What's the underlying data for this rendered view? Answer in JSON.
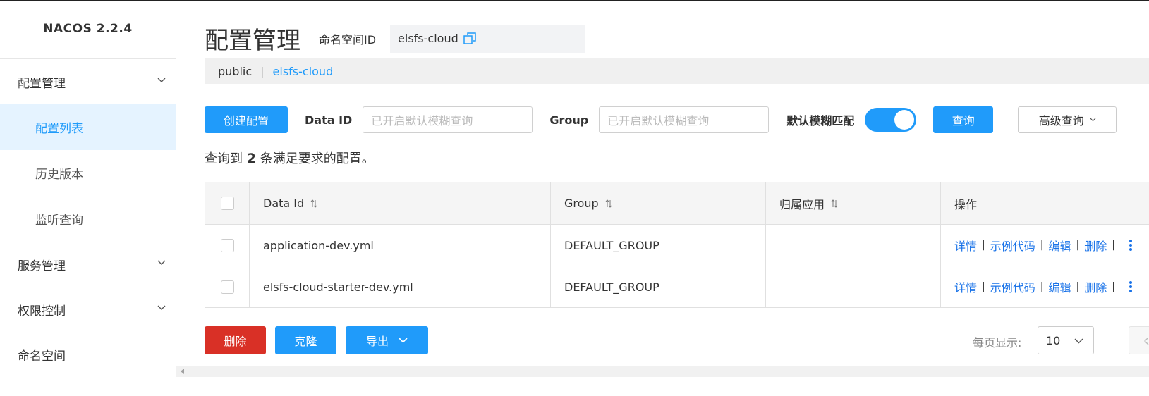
{
  "sidebar": {
    "brand": "NACOS 2.2.4",
    "groups": [
      {
        "label": "配置管理",
        "items": [
          "配置列表",
          "历史版本",
          "监听查询"
        ]
      },
      {
        "label": "服务管理"
      },
      {
        "label": "权限控制"
      },
      {
        "label": "命名空间"
      }
    ],
    "active_item": "配置列表"
  },
  "header": {
    "title": "配置管理",
    "namespace_label": "命名空间ID",
    "namespace_value": "elsfs-cloud"
  },
  "namespace_bar": {
    "items": [
      "public",
      "elsfs-cloud"
    ],
    "separator": "|",
    "selected": "elsfs-cloud"
  },
  "filters": {
    "create_label": "创建配置",
    "data_id_label": "Data ID",
    "data_id_placeholder": "已开启默认模糊查询",
    "group_label": "Group",
    "group_placeholder": "已开启默认模糊查询",
    "fuzzy_label": "默认模糊匹配",
    "fuzzy_on": true,
    "query_label": "查询",
    "advanced_label": "高级查询"
  },
  "result": {
    "prefix": "查询到",
    "count": "2",
    "suffix": "条满足要求的配置。"
  },
  "table": {
    "columns": [
      "Data Id",
      "Group",
      "归属应用",
      "操作"
    ],
    "rows": [
      {
        "data_id": "application-dev.yml",
        "group": "DEFAULT_GROUP",
        "app": ""
      },
      {
        "data_id": "elsfs-cloud-starter-dev.yml",
        "group": "DEFAULT_GROUP",
        "app": ""
      }
    ],
    "actions": [
      "详情",
      "示例代码",
      "编辑",
      "删除"
    ],
    "action_sep": "|"
  },
  "bottom": {
    "delete_label": "删除",
    "clone_label": "克隆",
    "export_label": "导出",
    "page_size_label": "每页显示:",
    "page_size": "10"
  },
  "colors": {
    "primary": "#209bfa",
    "danger": "#d93026",
    "link": "#1a73e8",
    "active_bg": "#e5f3ff"
  }
}
